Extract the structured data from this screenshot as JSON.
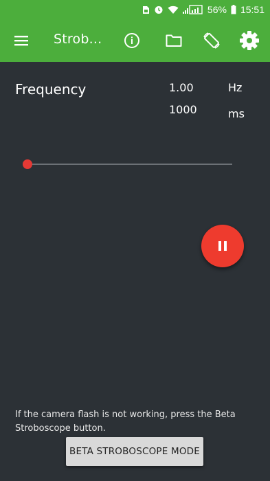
{
  "status_bar": {
    "battery_percent": "56%",
    "time": "15:51",
    "icons": [
      "sim-icon",
      "alarm-icon",
      "wifi-icon",
      "signal-icon",
      "battery-icon"
    ]
  },
  "toolbar": {
    "title": "Strob...",
    "icons": [
      "menu-icon",
      "info-icon",
      "folder-icon",
      "screen-rotation-icon",
      "settings-icon"
    ],
    "background": "#4cae3c"
  },
  "frequency": {
    "label": "Frequency",
    "value": "1.00",
    "unit": "Hz"
  },
  "period": {
    "value": "1000",
    "unit": "ms"
  },
  "slider": {
    "level": 0.0,
    "accent": "#e53935"
  },
  "fab": {
    "icon": "pause-icon",
    "color": "#ee3b2e"
  },
  "hint_text": "If the camera flash is not working, press the Beta Stroboscope button.",
  "beta_button_label": "BETA STROBOSCOPE MODE",
  "colors": {
    "background": "#2c3136",
    "primary": "#4cae3c",
    "accent": "#e53935"
  }
}
